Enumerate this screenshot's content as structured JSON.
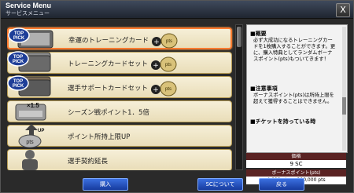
{
  "window": {
    "title": "Service Menu",
    "subtitle": "サービスメニュー",
    "close_label": "X"
  },
  "items": [
    {
      "label": "幸運のトレーニングカード",
      "badge": "TOP PICK",
      "pts": "pts",
      "selected": true
    },
    {
      "label": "トレーニングカードセット",
      "badge": "TOP PICK",
      "pts": "pts",
      "selected": false
    },
    {
      "label": "選手サポートカードセット",
      "badge": "TOP PICK",
      "pts": "pts",
      "selected": false
    },
    {
      "label": "シーズン戦ポイント1．5倍",
      "badge": "x1.5",
      "pts": "",
      "selected": false
    },
    {
      "label": "ポイント所持上限UP",
      "badge": "UP pts",
      "pts": "",
      "selected": false
    },
    {
      "label": "選手契約延長",
      "badge": "",
      "pts": "",
      "selected": false
    }
  ],
  "description": {
    "section1_title": "■概要",
    "section1_text": "必ず大成功になるトレーニングカードを1枚購入することができます。更に、購入特典としてランダムボーナスポイント(pts)もついてきます！",
    "section2_title": "■注意事項",
    "section2_text": "ボーナスポイント(pts)は所持上限を超えて獲得することはできません。",
    "section3_title": "■チケットを持っている時"
  },
  "price": {
    "label": "価格",
    "value": "9 SC"
  },
  "bonus": {
    "label": "ボーナスポイント(pts)",
    "value": "4,000 pts 〜 200,000 pts"
  },
  "buttons": {
    "buy": "購入",
    "about_sc": "SCについて",
    "back": "戻る"
  },
  "colors": {
    "accent_selected": "#ff7a2e",
    "button_blue": "#2a56c8",
    "header_red": "#5a2323"
  }
}
